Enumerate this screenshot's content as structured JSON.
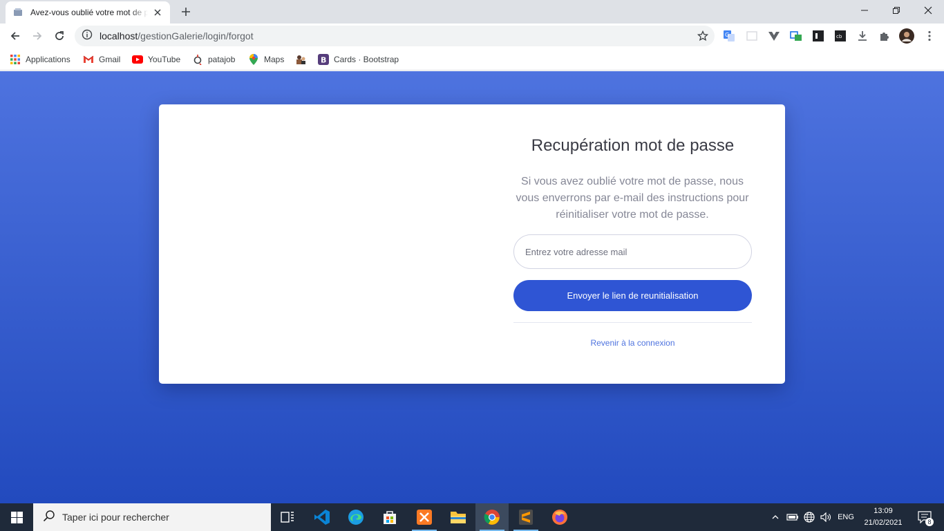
{
  "browser": {
    "tab": {
      "title": "Avez-vous oublié votre mot de passe ?"
    },
    "url": {
      "host": "localhost",
      "path": "/gestionGalerie/login/forgot"
    },
    "bookmarks": [
      {
        "label": "Applications",
        "icon": "apps-grid-icon"
      },
      {
        "label": "Gmail",
        "icon": "gmail-icon"
      },
      {
        "label": "YouTube",
        "icon": "youtube-icon"
      },
      {
        "label": "patajob",
        "icon": "patajob-icon"
      },
      {
        "label": "Maps",
        "icon": "maps-icon"
      },
      {
        "label": "",
        "icon": "bookmark-image-icon"
      },
      {
        "label": "Cards · Bootstrap",
        "icon": "bootstrap-icon"
      }
    ]
  },
  "page": {
    "heading": "Recupération mot de passe",
    "description": "Si vous avez oublié votre mot de passe, nous vous enverrons par e-mail des instructions pour réinitialiser votre mot de passe.",
    "email_placeholder": "Entrez votre adresse mail",
    "email_value": "",
    "submit_label": "Envoyer le lien de reunitialisation",
    "back_link": "Revenir à la connexion"
  },
  "taskbar": {
    "search_placeholder": "Taper ici pour rechercher",
    "language": "ENG",
    "time": "13:09",
    "date": "21/02/2021",
    "notification_count": "8"
  },
  "colors": {
    "gradient_top": "#4e73df",
    "gradient_bottom": "#224abe",
    "button": "#2f55d4",
    "link": "#4e73df"
  }
}
